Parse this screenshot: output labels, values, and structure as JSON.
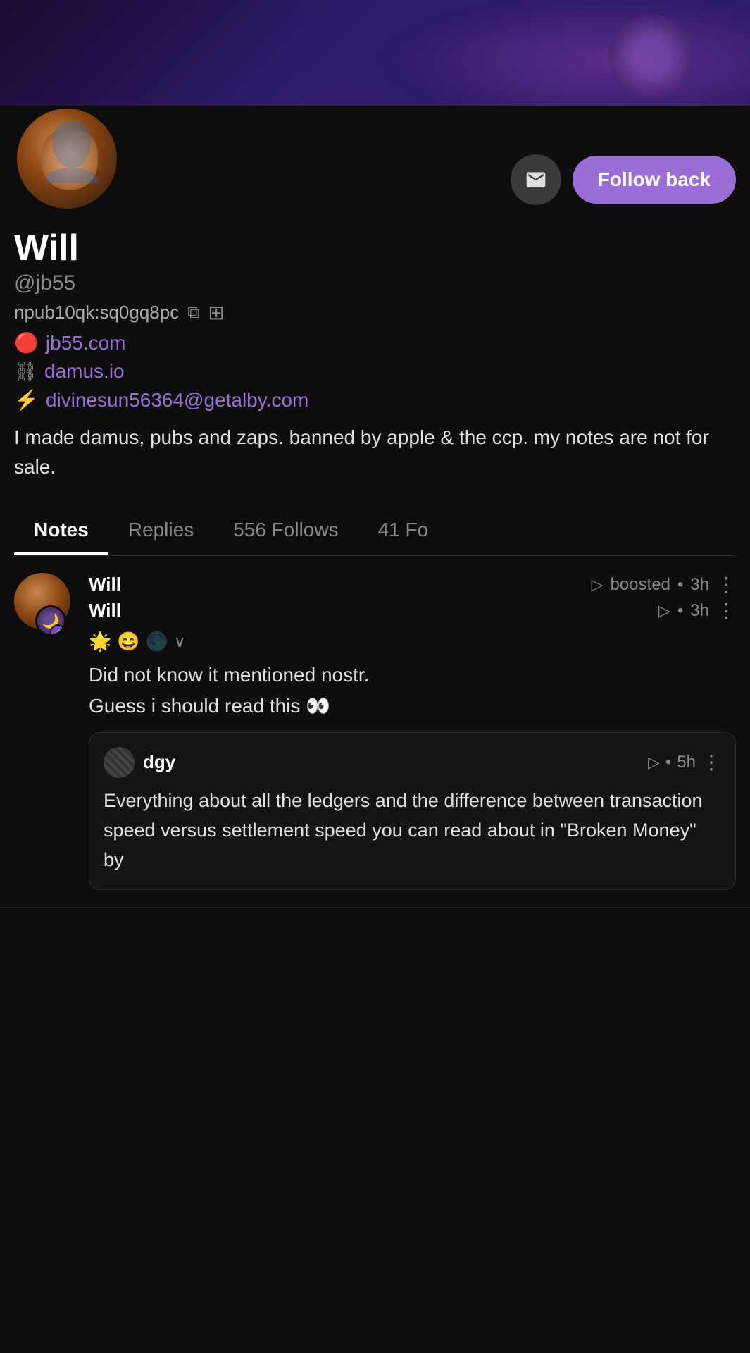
{
  "banner": {
    "alt": "Profile banner with purple hooded figure"
  },
  "profile": {
    "name": "Will",
    "handle": "@jb55",
    "npub": "npub10qk:sq0gq8pc",
    "website1": "jb55.com",
    "website2": "damus.io",
    "lightning": "divinesun56364@getalby.com",
    "bio": "I made damus, pubs and zaps. banned by apple & the ccp. my notes are not for sale.",
    "follow_back_label": "Follow back",
    "message_label": "Message"
  },
  "tabs": [
    {
      "id": "notes",
      "label": "Notes",
      "active": true
    },
    {
      "id": "replies",
      "label": "Replies",
      "active": false
    },
    {
      "id": "follows",
      "label": "556 Follows",
      "active": false
    },
    {
      "id": "followers",
      "label": "41 Fo",
      "active": false
    }
  ],
  "posts": [
    {
      "author": "Will",
      "author2": "Will",
      "boosted_label": "boosted",
      "time1": "3h",
      "time2": "3h",
      "text": "Did not know it mentioned nostr. Guess i should read this 👀",
      "reactions": [
        "🌟",
        "😄",
        "🌑"
      ],
      "quoted": {
        "author": "dgy",
        "time": "5h",
        "text": "Everything about all the ledgers and the difference between transaction speed versus settlement speed you can read about in \"Broken Money\" by"
      }
    }
  ],
  "icons": {
    "envelope": "✉",
    "copy": "⧉",
    "qr": "⊞",
    "warning": "🔴",
    "chain": "⛓",
    "zap": "⚡",
    "boost": "▷",
    "more": "⋮",
    "accessibility": "♿"
  }
}
